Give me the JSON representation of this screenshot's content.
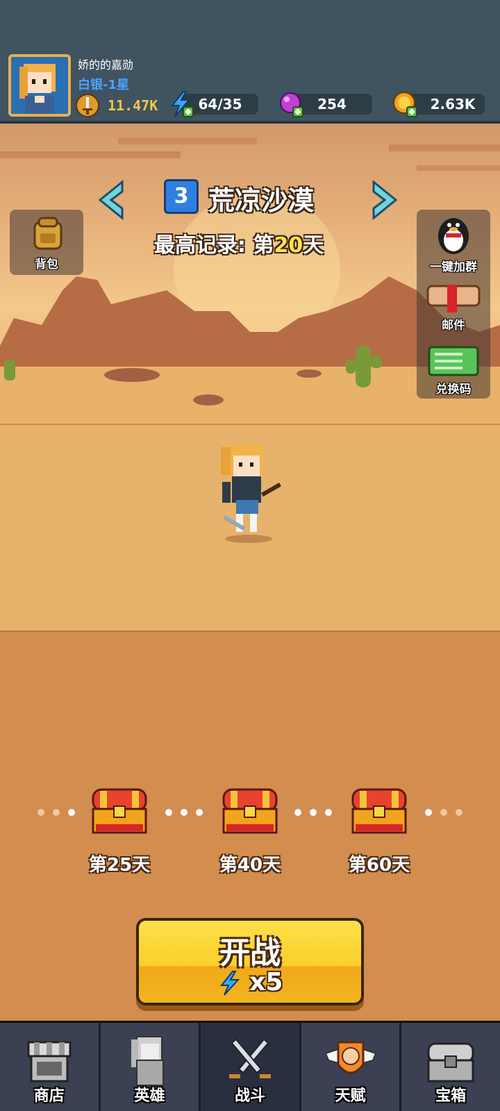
{
  "player": {
    "name": "娇的的嘉勋",
    "rank": "白银-1星",
    "power": "11.47K"
  },
  "resources": {
    "energy": "64/35",
    "gems": "254",
    "gold": "2.63K"
  },
  "stage": {
    "number": "3",
    "name": "荒凉沙漠",
    "record_prefix": "最高记录: 第",
    "record_day": "20",
    "record_suffix": "天"
  },
  "side_buttons": {
    "backpack": "背包",
    "join_group": "一键加群",
    "mail": "邮件",
    "redeem": "兑换码"
  },
  "milestones": [
    {
      "label": "第25天"
    },
    {
      "label": "第40天"
    },
    {
      "label": "第60天"
    }
  ],
  "start_button": {
    "label": "开战",
    "cost": "x5"
  },
  "nav": [
    {
      "label": "商店",
      "icon": "shop-icon"
    },
    {
      "label": "英雄",
      "icon": "hero-icon"
    },
    {
      "label": "战斗",
      "icon": "battle-icon"
    },
    {
      "label": "天赋",
      "icon": "talent-icon"
    },
    {
      "label": "宝箱",
      "icon": "chest-icon"
    }
  ],
  "colors": {
    "header_bg": "#3f5360",
    "rank": "#4aa3ff",
    "power": "#f6c846",
    "record_highlight": "#ffe14a",
    "start_button": "#f9cf2a",
    "nav_bg": "#3b4152"
  }
}
